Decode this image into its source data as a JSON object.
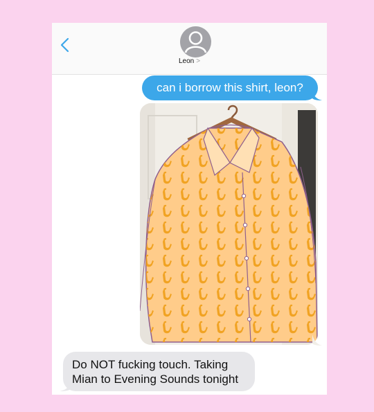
{
  "conversation": {
    "contact_name": "Leon",
    "contact_chevron": ">"
  },
  "messages": [
    {
      "from": "me",
      "text": "can i borrow this shirt, leon?"
    },
    {
      "from": "me",
      "attachment": "photo of orange saxophone-print button-up shirt on a hanger"
    },
    {
      "from": "contact",
      "text": "Do NOT fucking touch. Taking\nMian to Evening Sounds tonight"
    }
  ],
  "colors": {
    "background": "#fbd3ee",
    "outgoing_bubble": "#3ca7e9",
    "incoming_bubble": "#e7e7ea",
    "accent_back": "#3ca7e9",
    "shirt": "#ffcc8a",
    "sax_print": "#f0a11e"
  },
  "icons": {
    "back": "chevron-left-icon",
    "avatar": "person-silhouette-icon"
  }
}
